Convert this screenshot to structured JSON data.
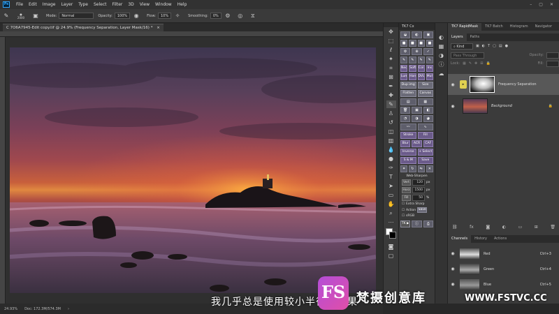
{
  "menu": [
    "File",
    "Edit",
    "Image",
    "Layer",
    "Type",
    "Select",
    "Filter",
    "3D",
    "View",
    "Window",
    "Help"
  ],
  "options": {
    "mode_label": "Mode:",
    "mode_value": "Normal",
    "opacity_label": "Opacity:",
    "opacity_value": "100%",
    "flow_label": "Flow:",
    "flow_value": "10%",
    "smoothing_label": "Smoothing:",
    "smoothing_value": "0%",
    "brush_size": "2000"
  },
  "document": {
    "tab_title": "C 7O6A7945-Edit copy.tif @ 24.9% (Frequency Separation, Layer Mask/16) *",
    "zoom": "24.93%",
    "doc_info": "Doc: 172.3M/574.3M"
  },
  "tk7": {
    "title": "TK7 Cx",
    "buttons": [
      "Neon",
      "Soft",
      "Col",
      "Ins",
      "Lum",
      "Hard",
      "DVL",
      "Mult",
      "Dup img",
      "Size",
      "Flatten",
      "Canvas",
      "Stroke",
      "Fill",
      "Blur",
      "ACR",
      "CAF",
      "Inverse",
      "+ Select",
      "S & M",
      "Save"
    ],
    "web_sharpen": "Web-Sharpen",
    "vert_label": "Vert",
    "vert_value": "120",
    "vert_unit": "px",
    "horz_label": "Horz",
    "horz_value": "1500",
    "horz_unit": "px",
    "fill_label": "Fill",
    "fill_value": "50",
    "fill_unit": "%",
    "extra_sharp": "Extra Sharp",
    "action": "Action",
    "srgb": "sRGB",
    "save_btn": "Save",
    "footer": "TK ▶"
  },
  "panels": {
    "top_tabs": [
      "TK7 RapidMask",
      "TK7 Batch",
      "Histogram",
      "Navigator"
    ],
    "layer_tabs": [
      "Layers",
      "Paths"
    ],
    "kind": "Kind",
    "blend_mode": "Pass Through",
    "opacity_label": "Opacity:",
    "lock_label": "Lock:",
    "fill_label": "Fill:",
    "layers": [
      {
        "name": "Frequency Separation"
      },
      {
        "name": "Background"
      }
    ],
    "bottom_tabs": [
      "Channels",
      "History",
      "Actions"
    ],
    "channels": [
      {
        "name": "Red",
        "shortcut": "Ctrl+3"
      },
      {
        "name": "Green",
        "shortcut": "Ctrl+4"
      },
      {
        "name": "Blue",
        "shortcut": "Ctrl+5"
      }
    ]
  },
  "overlay": {
    "subtitle": "我几乎总是使用较小半径的效果",
    "logo": "FS",
    "brand": "梵摄创意库",
    "url": "WWW.FSTVC.CC"
  },
  "colors": {
    "accent": "#31a8ff",
    "watermark": "#c44fd0",
    "tk_button": "#6b6b78"
  }
}
